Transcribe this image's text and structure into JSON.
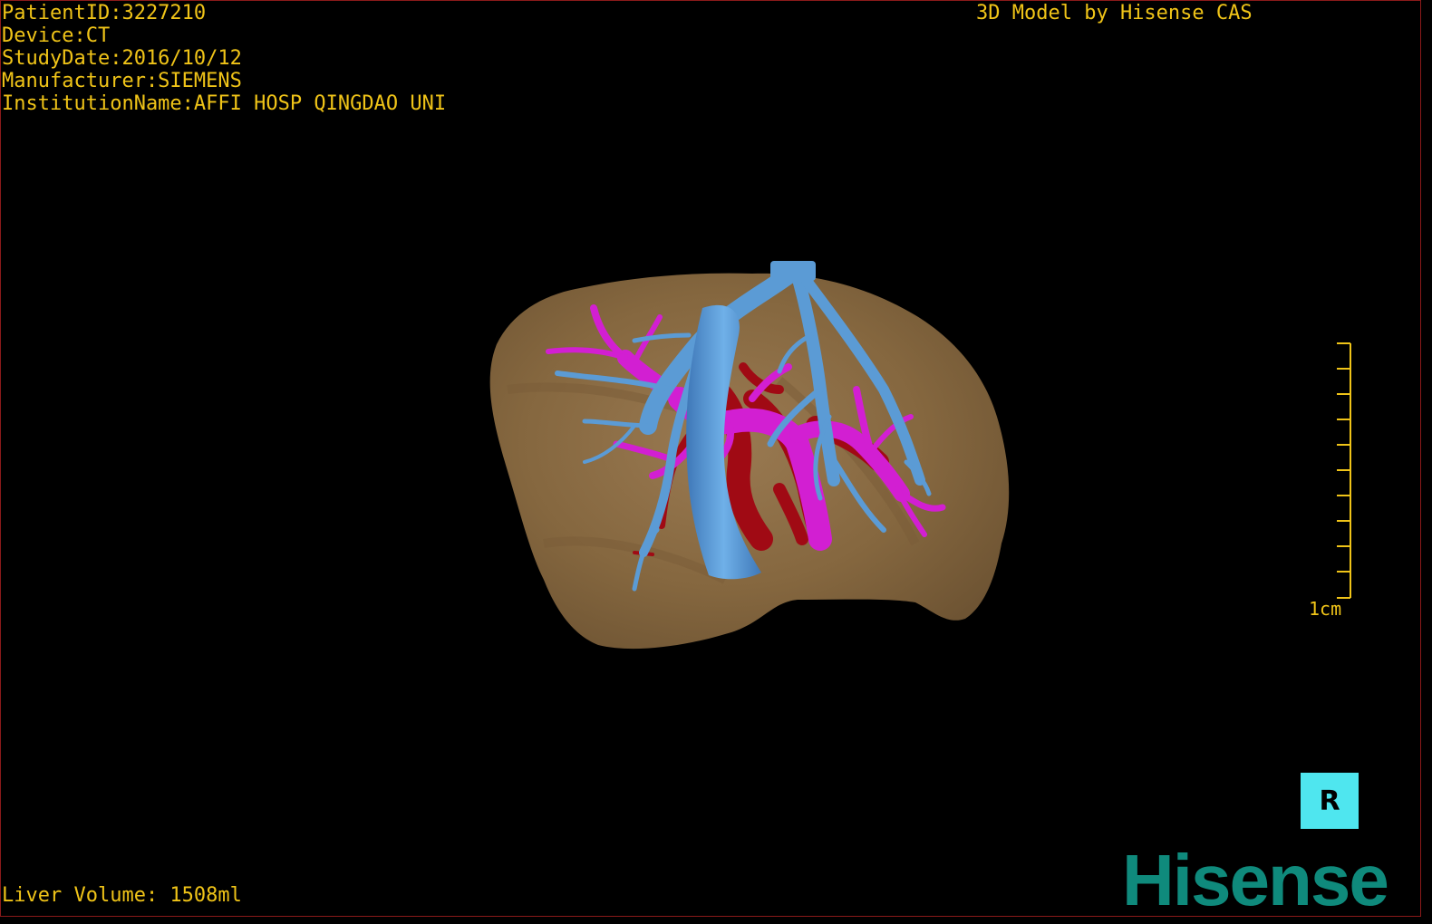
{
  "info": {
    "patient_id": "PatientID:3227210",
    "device": "Device:CT",
    "study_date": "StudyDate:2016/10/12",
    "manufacturer": "Manufacturer:SIEMENS",
    "institution": "InstitutionName:AFFI HOSP QINGDAO UNI"
  },
  "watermark": "3D Model by Hisense CAS",
  "footer": {
    "liver_volume": "Liver Volume: 1508ml"
  },
  "scale": {
    "label": "1cm"
  },
  "orientation": {
    "label": "R"
  },
  "brand": {
    "logo_text": "Hisense"
  },
  "colors": {
    "text": "#f0c418",
    "liver": "#8b6b45",
    "hepatic_vein": "#5b9bd5",
    "portal_vein": "#d21fd2",
    "artery": "#a00a14",
    "orient_button": "#4fe6ef",
    "brand": "#0f8a7c"
  }
}
